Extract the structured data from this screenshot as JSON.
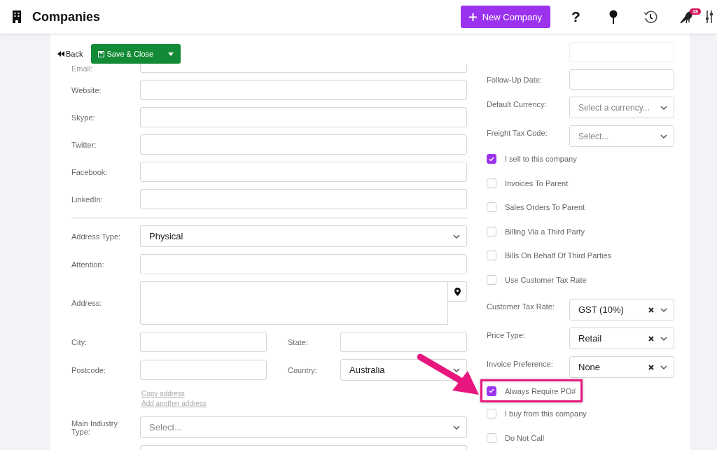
{
  "header": {
    "title": "Companies",
    "new_button": "New Company",
    "help_glyph": "?",
    "notification_count": "38"
  },
  "toolbar": {
    "back": "Back",
    "save": "Save & Close"
  },
  "left": [
    {
      "kind": "input",
      "label": "Email:"
    },
    {
      "kind": "input",
      "label": "Website:"
    },
    {
      "kind": "input",
      "label": "Skype:"
    },
    {
      "kind": "input",
      "label": "Twitter:"
    },
    {
      "kind": "input",
      "label": "Facebook:"
    },
    {
      "kind": "input",
      "label": "LinkedIn:"
    },
    {
      "kind": "divider"
    },
    {
      "kind": "select",
      "label": "Address Type:",
      "value": "Physical"
    },
    {
      "kind": "input",
      "label": "Attention:"
    },
    {
      "kind": "textarea",
      "label": "Address:"
    },
    {
      "kind": "pair",
      "fields": [
        {
          "kind": "input",
          "label": "City:"
        },
        {
          "kind": "input",
          "label": "State:"
        }
      ]
    },
    {
      "kind": "pair",
      "fields": [
        {
          "kind": "input",
          "label": "Postcode:"
        },
        {
          "kind": "select",
          "label": "Country:",
          "value": "Australia"
        }
      ]
    },
    {
      "kind": "links",
      "links": [
        "Copy address",
        "Add another address"
      ]
    },
    {
      "kind": "select",
      "label": "Main Industry Type:",
      "placeholder": "Select..."
    },
    {
      "kind": "input"
    }
  ],
  "right": [
    {
      "kind": "input"
    },
    {
      "kind": "input",
      "label": "Follow-Up Date:"
    },
    {
      "kind": "select",
      "label": "Default Currency:",
      "placeholder": "Select a currency..."
    },
    {
      "kind": "select",
      "label": "Freight Tax Code:",
      "placeholder": "Select..."
    },
    {
      "kind": "checkbox",
      "label": "I sell to this company",
      "checked": true
    },
    {
      "kind": "checkbox",
      "label": "Invoices To Parent",
      "checked": false
    },
    {
      "kind": "checkbox",
      "label": "Sales Orders To Parent",
      "checked": false
    },
    {
      "kind": "checkbox",
      "label": "Billing Via a Third Party",
      "checked": false
    },
    {
      "kind": "checkbox",
      "label": "Bills On Behalf Of Third Parties",
      "checked": false
    },
    {
      "kind": "checkbox",
      "label": "Use Customer Tax Rate",
      "checked": false
    },
    {
      "kind": "select",
      "label": "Customer Tax Rate:",
      "value": "GST (10%)",
      "clearable": true
    },
    {
      "kind": "select",
      "label": "Price Type:",
      "value": "Retail",
      "clearable": true
    },
    {
      "kind": "select",
      "label": "Invoice Preference:",
      "value": "None",
      "clearable": true
    },
    {
      "kind": "checkbox",
      "label": "Always Require PO#",
      "checked": true,
      "highlighted": true
    },
    {
      "kind": "checkbox",
      "label": "I buy from this company",
      "checked": false
    },
    {
      "kind": "checkbox",
      "label": "Do Not Call",
      "checked": false
    }
  ]
}
